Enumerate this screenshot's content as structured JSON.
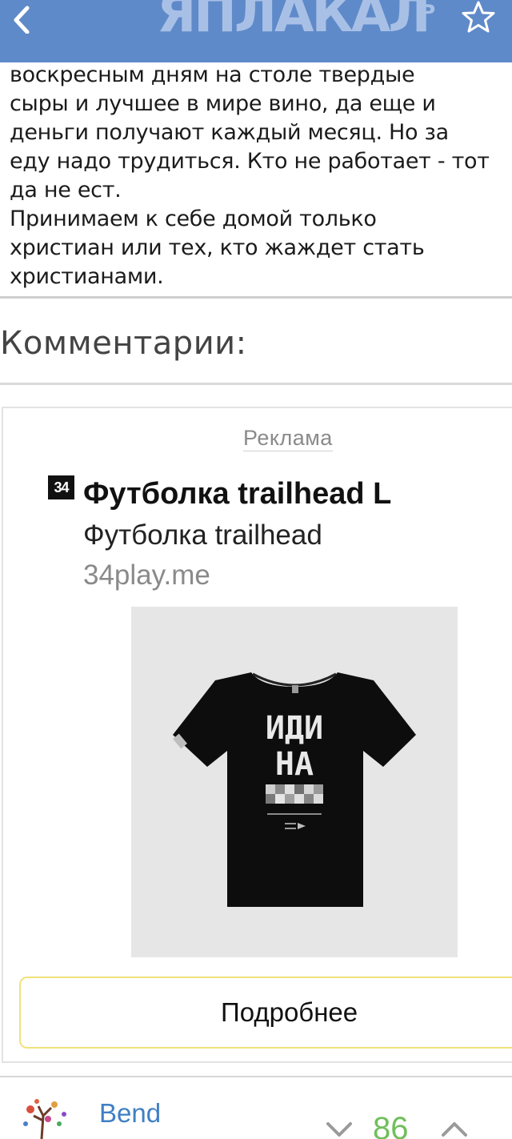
{
  "header": {
    "logo_text": "ЯПЛАКАЛ",
    "logo_sup": "Ъ",
    "back_icon": "chevron-left-icon",
    "favorite_icon": "star-outline-icon",
    "bar_color": "#5f8ac9"
  },
  "post": {
    "lines": [
      "воскресным дням на столе твердые",
      "сыры и лучшее в мире вино, да еще и",
      "деньги получают каждый месяц.  Но за",
      "еду надо трудиться. Кто не работает - тот",
      "да не ест.",
      "Принимаем к себе домой только",
      "христиан или тех, кто жаждет стать",
      "христианами."
    ]
  },
  "comments_section": {
    "title": "Комментарии:"
  },
  "ad": {
    "label": "Реклама",
    "logo_text": "34",
    "title": "Футболка trailhead L",
    "subtitle": "Футболка trailhead",
    "domain": "34play.me",
    "button_label": "Подробнее",
    "button_border_color": "#f1e27a",
    "tshirt_text": [
      "ИДИ",
      "НА"
    ]
  },
  "comment": {
    "username": "Bend",
    "score": "86",
    "score_color": "#6fbf5a"
  }
}
